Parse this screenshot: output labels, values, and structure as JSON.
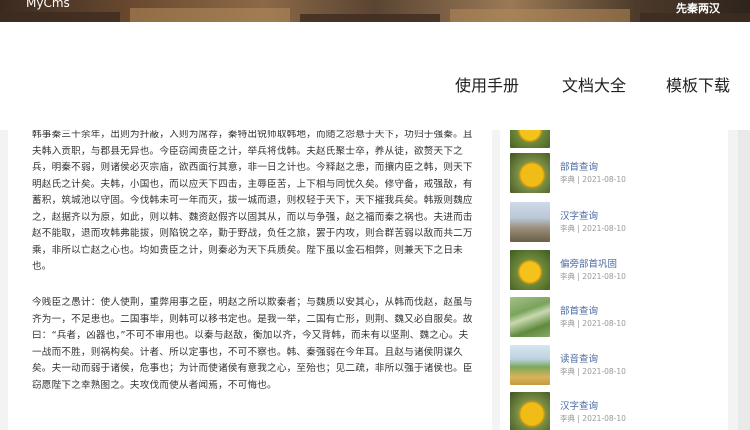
{
  "banner": {
    "logo": "MyCms",
    "right_text": "先秦两汉"
  },
  "nav": {
    "items": [
      "使用手册",
      "文档大全",
      "模板下载"
    ]
  },
  "article": {
    "paragraphs": [
      "韩事秦三十余年，出则为扞蔽，入则为席荐，秦特出锐师取韩地，而随之怨悬于天下，功归于强秦。且夫韩入贡职，与郡县无异也。今臣窃闻贵臣之计，举兵将伐韩。夫赵氏聚士卒，养从徒，欲赘天下之兵，明秦不弱，则诸侯必灭宗庙，欲西面行其意，非一日之计也。今释赵之患，而攘内臣之韩，则天下明赵氏之计矣。夫韩，小国也，而以应天下四击，主辱臣苦，上下相与同忧久矣。修守备，戒强敌，有蓄积，筑城池以守固。今伐韩未可一年而灭，拔一城而退，则权轻于天下，天下摧我兵矣。韩叛则魏应之，赵据齐以为原，如此，则以韩、魏资赵假齐以固其从，而以与争强，赵之福而秦之祸也。夫进而击赵不能取，退而攻韩弗能拔，则陷锐之卒，勤于野战，负任之旅，罢于内攻，则合群苦弱以敌而共二万乘，非所以亡赵之心也。均如贵臣之计，则秦必为天下兵质矣。陛下虽以金石相弊，则兼天下之日未也。",
      "今贱臣之愚计：使人使荆，重弊用事之臣，明赵之所以欺秦者；与魏质以安其心，从韩而伐赵，赵虽与齐为一，不足患也。二国事毕，则韩可以移书定也。是我一举，二国有亡形，则荆、魏又必自服矣。故曰：“兵者，凶器也，”不可不审用也。以秦与赵敌，衡加以齐，今又背韩，而未有以坚荆、魏之心。夫一战而不胜，则祸构矣。计者、所以定事也，不可不察也。韩、秦强弱在今年耳。且赵与诸侯阴谋久矣。夫一动而弱于诸侯，危事也；为计而使诸侯有意我之心，至殆也；见二疏，非所以强于诸侯也。臣窃愿陛下之幸熟图之。夫攻伐而使从者闻焉，不可悔也。"
    ]
  },
  "sidebar": {
    "items": [
      {
        "title": "",
        "meta": "",
        "thumb": "flower"
      },
      {
        "title": "部首查询",
        "meta": "李典 | 2021-08-10",
        "thumb": "flower2"
      },
      {
        "title": "汉字查询",
        "meta": "李典 | 2021-08-10",
        "thumb": "sky"
      },
      {
        "title": "偏旁部首巩固",
        "meta": "李典 | 2021-08-10",
        "thumb": "flower"
      },
      {
        "title": "部首查询",
        "meta": "李典 | 2021-08-10",
        "thumb": "plant"
      },
      {
        "title": "读音查询",
        "meta": "李典 | 2021-08-10",
        "thumb": "field"
      },
      {
        "title": "汉字查询",
        "meta": "李典 | 2021-08-10",
        "thumb": "flower2"
      }
    ]
  }
}
